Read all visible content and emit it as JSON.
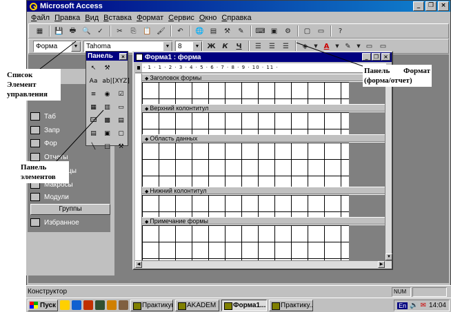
{
  "app": {
    "title": "Microsoft Access"
  },
  "window_buttons": {
    "minimize": "_",
    "restore": "❐",
    "close": "×"
  },
  "menu": [
    "Файл",
    "Правка",
    "Вид",
    "Вставка",
    "Формат",
    "Сервис",
    "Окно",
    "Справка"
  ],
  "format_toolbar": {
    "object_combo": "Форма",
    "font_combo": "Tahoma",
    "size_combo": "8",
    "bold": "Ж",
    "italic": "К",
    "underline": "Ч"
  },
  "toolbox_panel": {
    "title": "Панель",
    "tools": [
      "↖",
      "⚒",
      "",
      "Аа",
      "ab|",
      "[XYZ]",
      "≡",
      "◉",
      "☑",
      "▦",
      "▥",
      "▭",
      "🖾",
      "▩",
      "▤",
      "▤",
      "▣",
      "▢",
      "╲",
      "□",
      "⚒"
    ]
  },
  "db_window": {
    "items": [
      "Таб",
      "Запр",
      "Фор",
      "Отчеты",
      "Страницы",
      "Макросы",
      "Модули"
    ],
    "groups_label": "Группы",
    "favorites": "Избранное"
  },
  "form_window": {
    "title": "Форма1 : форма",
    "ruler_ticks": "·  1  ·  1  ·  2  ·  3  ·  4  ·  5  ·  6  ·  7  ·  8  ·  9  ·  10  ·  11  ·",
    "sections": [
      "Заголовок формы",
      "Верхний колонтитул",
      "Область данных",
      "Нижний колонтитул",
      "Примечание формы"
    ]
  },
  "status_bar": {
    "text": "Конструктор",
    "num": "NUM"
  },
  "taskbar": {
    "start": "Пуск",
    "tasks": [
      "Практикум",
      "AKADEM ...",
      "Форма1....",
      "Практику..."
    ],
    "active_index": 2,
    "lang": "En",
    "time": "14:04"
  },
  "annotations": {
    "list_controls": "Список Элемент управления",
    "panel_format": "Панель Формат (форма/отчет)",
    "panel_elements": "Панель элементов"
  }
}
